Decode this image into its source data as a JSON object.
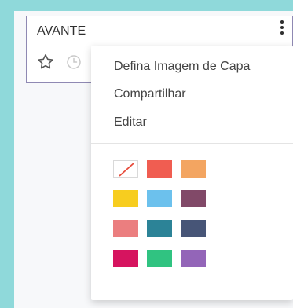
{
  "card": {
    "title": "AVANTE",
    "star_icon": "star-outline-icon",
    "clock_icon": "clock-icon"
  },
  "menu": {
    "items": [
      {
        "label": "Defina Imagem de Capa"
      },
      {
        "label": "Compartilhar"
      },
      {
        "label": "Editar"
      }
    ],
    "colors": [
      "none",
      "#f05d51",
      "#f3a561",
      "#f7cd1f",
      "#6cc1ed",
      "#814968",
      "#eb7e7f",
      "#2c8397",
      "#475577",
      "#d6145f",
      "#30c381",
      "#9365b8"
    ]
  },
  "colors": {
    "page_background": "#8fd9da",
    "panel_background": "#f7f8fa",
    "card_border": "#8f89b3",
    "none_swatch_slash": "#e74c3c"
  },
  "icons": {
    "menu_toggle": "kebab-vertical-icon"
  }
}
